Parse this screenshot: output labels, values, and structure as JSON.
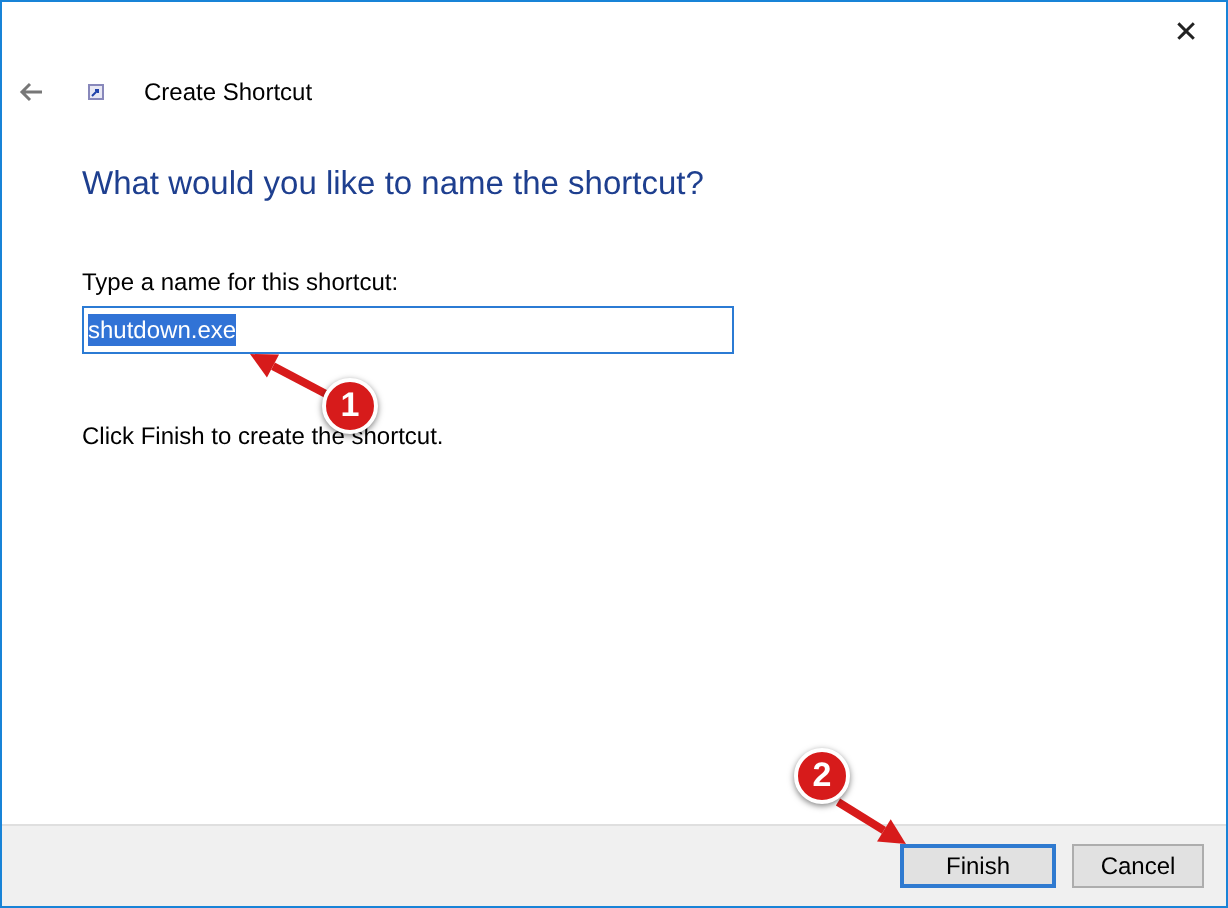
{
  "window": {
    "close_glyph": "✕",
    "title": "Create Shortcut"
  },
  "heading": "What would you like to name the shortcut?",
  "name_field": {
    "label": "Type a name for this shortcut:",
    "value": "shutdown.exe",
    "text_selected": true
  },
  "hint": "Click Finish to create the shortcut.",
  "buttons": [
    {
      "label": "Finish",
      "default": true
    },
    {
      "label": "Cancel",
      "default": false
    }
  ],
  "annotations": [
    {
      "label": "1"
    },
    {
      "label": "2"
    }
  ]
}
